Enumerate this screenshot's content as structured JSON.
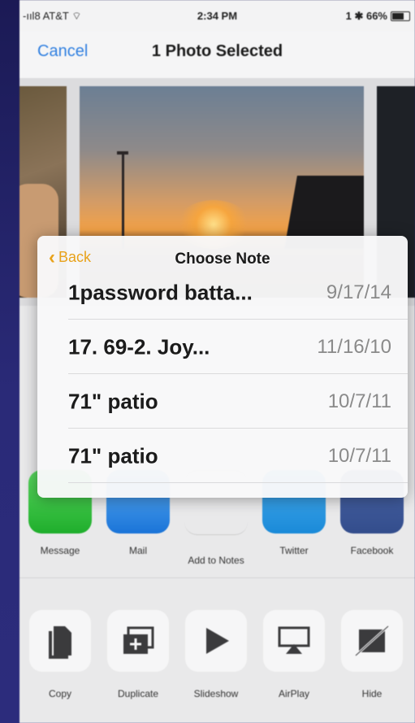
{
  "status": {
    "carrier": "-ııl8 AT&T ⌔",
    "time": "2:34 PM",
    "battery": "1 ✱ 66%"
  },
  "nav": {
    "cancel": "Cancel",
    "title": "1 Photo Selected"
  },
  "popup": {
    "back": "Back",
    "title": "Choose Note",
    "notes": [
      {
        "title": "1password batta...",
        "date": "9/17/14"
      },
      {
        "title": "17.    69-2. Joy...",
        "date": "11/16/10"
      },
      {
        "title": "71\" patio",
        "date": "10/7/11"
      },
      {
        "title": "71\" patio",
        "date": "10/7/11"
      }
    ]
  },
  "share_apps": [
    {
      "label": "Message",
      "icon": "message-icon"
    },
    {
      "label": "Mail",
      "icon": "mail-icon"
    },
    {
      "label": "Add to Notes",
      "icon": "notes-icon"
    },
    {
      "label": "Twitter",
      "icon": "twitter-icon"
    },
    {
      "label": "Facebook",
      "icon": "facebook-icon"
    }
  ],
  "actions": [
    {
      "label": "Copy",
      "icon": "copy-icon"
    },
    {
      "label": "Duplicate",
      "icon": "duplicate-icon"
    },
    {
      "label": "Slideshow",
      "icon": "slideshow-icon"
    },
    {
      "label": "AirPlay",
      "icon": "airplay-icon"
    },
    {
      "label": "Hide",
      "icon": "hide-icon"
    }
  ],
  "colors": {
    "accent_blue": "#2f7fe0",
    "back_orange": "#e8a21b"
  }
}
